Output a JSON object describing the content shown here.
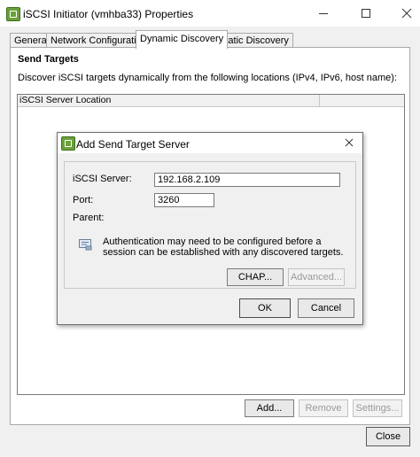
{
  "window": {
    "title": "iSCSI Initiator (vmhba33) Properties",
    "icon": "vmware-app-icon",
    "controls": [
      "minimize-icon",
      "maximize-icon",
      "close-icon"
    ]
  },
  "tabs": [
    {
      "label": "General",
      "active": false
    },
    {
      "label": "Network Configuration",
      "active": false
    },
    {
      "label": "Dynamic Discovery",
      "active": true
    },
    {
      "label": "Static Discovery",
      "active": false
    }
  ],
  "panel": {
    "section_title": "Send Targets",
    "description": "Discover iSCSI targets dynamically from the following locations (IPv4, IPv6, host name):",
    "list_columns": [
      "iSCSI Server Location",
      ""
    ],
    "buttons": {
      "add": "Add...",
      "remove": "Remove",
      "settings": "Settings..."
    }
  },
  "footer": {
    "close": "Close"
  },
  "dialog": {
    "title": "Add Send Target Server",
    "server_label": "iSCSI Server:",
    "server_value": "192.168.2.109",
    "port_label": "Port:",
    "port_value": "3260",
    "parent_label": "Parent:",
    "info_text": "Authentication may need to be configured before a session can be established with any discovered targets.",
    "chap_label": "CHAP...",
    "advanced_label": "Advanced...",
    "ok_label": "OK",
    "cancel_label": "Cancel"
  },
  "colors": {
    "accent": "#6aa03a",
    "panel_bg": "#ffffff",
    "window_bg": "#f0f0f0"
  }
}
